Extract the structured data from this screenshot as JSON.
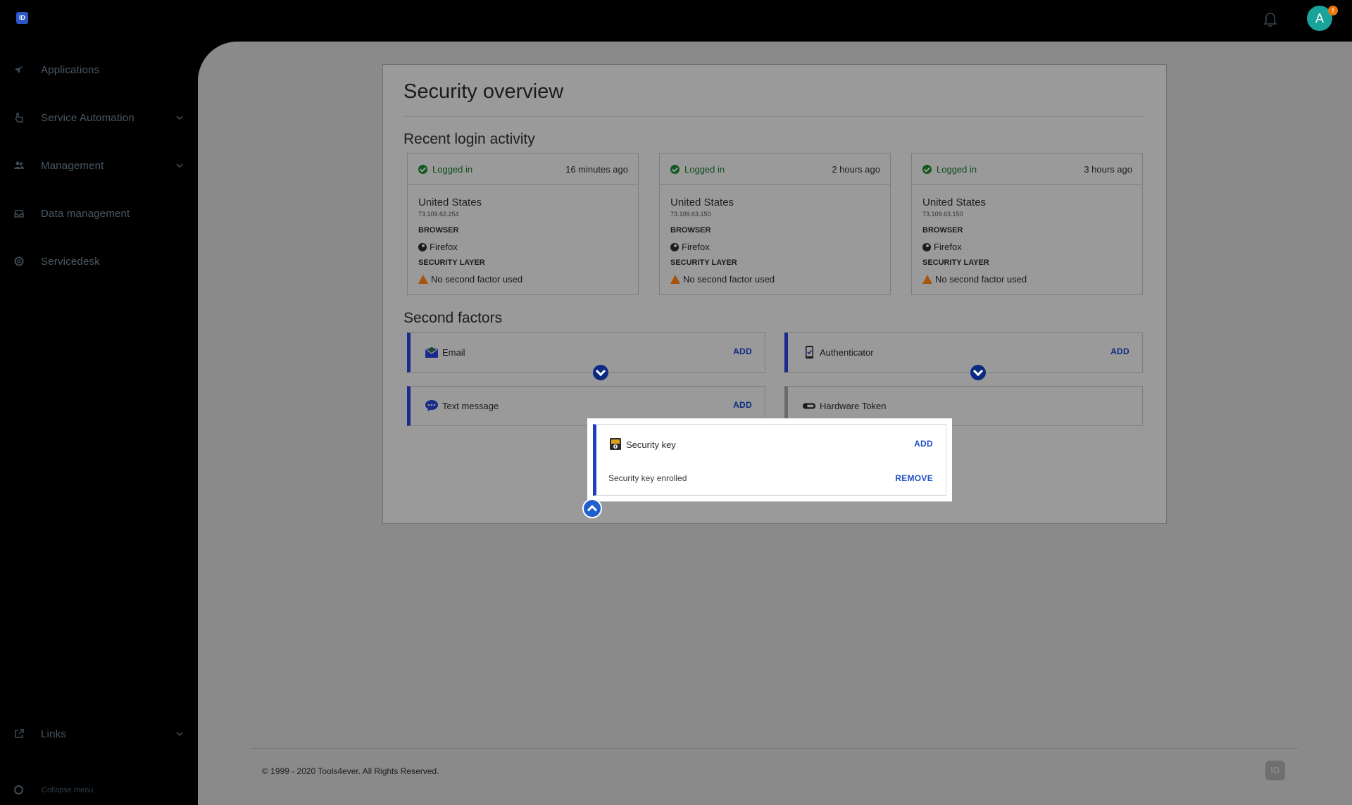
{
  "topbar": {
    "logo_text": "ID",
    "avatar_initial": "A",
    "avatar_badge": "!"
  },
  "sidebar": {
    "items": [
      {
        "label": "Applications",
        "icon": "rocket-icon"
      },
      {
        "label": "Service Automation",
        "icon": "hand-pointer-icon",
        "expandable": true
      },
      {
        "label": "Management",
        "icon": "users-icon",
        "expandable": true
      },
      {
        "label": "Data management",
        "icon": "inbox-icon"
      },
      {
        "label": "Servicedesk",
        "icon": "lifebuoy-icon"
      }
    ],
    "links": {
      "label": "Links",
      "icon": "external-link-icon"
    },
    "collapse": {
      "label": "Collapse menu",
      "icon": "circle-icon"
    }
  },
  "page": {
    "title": "Security overview",
    "recent_title": "Recent login activity",
    "factors_title": "Second factors",
    "browser_caption": "BROWSER",
    "security_caption": "SECURITY LAYER"
  },
  "logins": [
    {
      "status": "Logged in",
      "time": "16 minutes ago",
      "country": "United States",
      "ip": "73.109.62.254",
      "browser": "Firefox",
      "security": "No second factor used"
    },
    {
      "status": "Logged in",
      "time": "2 hours ago",
      "country": "United States",
      "ip": "73.109.63.150",
      "browser": "Firefox",
      "security": "No second factor used"
    },
    {
      "status": "Logged in",
      "time": "3 hours ago",
      "country": "United States",
      "ip": "73.109.63.150",
      "browser": "Firefox",
      "security": "No second factor used"
    }
  ],
  "factors": {
    "email": {
      "name": "Email",
      "action": "ADD"
    },
    "authenticator": {
      "name": "Authenticator",
      "action": "ADD"
    },
    "text": {
      "name": "Text message",
      "action": "ADD"
    },
    "hardware": {
      "name": "Hardware Token"
    },
    "security_key": {
      "name": "Security key",
      "action": "ADD",
      "enrolled": "Security key enrolled",
      "remove": "REMOVE"
    }
  },
  "footer": {
    "copyright": "© 1999 - 2020 Tools4ever. All Rights Reserved.",
    "logo_text": "ID"
  },
  "colors": {
    "accent": "#1f4fc8",
    "success": "#0f5a1f",
    "warning": "#a9530c",
    "avatar": "#1aa39a"
  }
}
